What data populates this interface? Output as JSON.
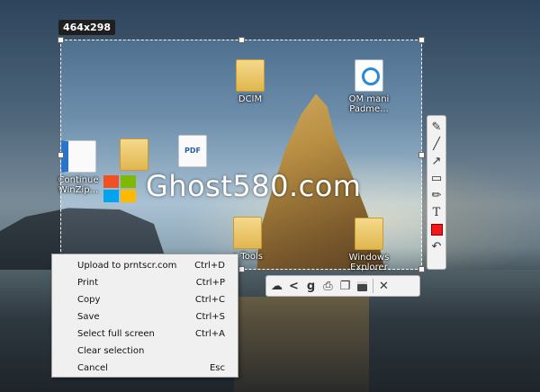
{
  "selection": {
    "size_label": "464x298"
  },
  "watermark": "Ghost580.com",
  "desktop_icons": [
    {
      "label": "DCIM",
      "icon": "folder-icon"
    },
    {
      "label": "OM mani\nPadme...",
      "icon": "app-icon"
    },
    {
      "label": "Continue\nWinZip...",
      "icon": "document-icon"
    },
    {
      "label": "",
      "icon": "folder-icon"
    },
    {
      "label": "",
      "icon": "pdf-document-icon",
      "glyph_text": "PDF"
    },
    {
      "label": "e Tools",
      "icon": "zip-folder-icon"
    },
    {
      "label": "Windows\nExplorer",
      "icon": "folder-icon"
    }
  ],
  "vertical_toolbar": {
    "tools": [
      {
        "name": "pen-tool",
        "glyph": "✎"
      },
      {
        "name": "line-tool",
        "glyph": "╱"
      },
      {
        "name": "arrow-tool",
        "glyph": "↗"
      },
      {
        "name": "rectangle-tool",
        "glyph": "▭"
      },
      {
        "name": "marker-tool",
        "glyph": "✏"
      },
      {
        "name": "text-tool",
        "glyph": "T"
      },
      {
        "name": "color-picker",
        "color": "#f21818"
      },
      {
        "name": "undo-tool",
        "glyph": "↶"
      }
    ]
  },
  "horizontal_toolbar": {
    "tools": [
      {
        "name": "upload-cloud",
        "glyph": "☁"
      },
      {
        "name": "share",
        "glyph": "<"
      },
      {
        "name": "google-search",
        "glyph": "g"
      },
      {
        "name": "print",
        "glyph": "⎙"
      },
      {
        "name": "copy",
        "glyph": "❐"
      },
      {
        "name": "save",
        "glyph": "💾"
      },
      {
        "name": "close",
        "glyph": "✕"
      }
    ]
  },
  "context_menu": {
    "items": [
      {
        "label": "Upload to prntscr.com",
        "shortcut": "Ctrl+D"
      },
      {
        "label": "Print",
        "shortcut": "Ctrl+P"
      },
      {
        "label": "Copy",
        "shortcut": "Ctrl+C"
      },
      {
        "label": "Save",
        "shortcut": "Ctrl+S"
      },
      {
        "label": "Select full screen",
        "shortcut": "Ctrl+A"
      },
      {
        "label": "Clear selection",
        "shortcut": ""
      },
      {
        "label": "Cancel",
        "shortcut": "Esc"
      }
    ]
  },
  "colors": {
    "logo": [
      "#f25022",
      "#7fba00",
      "#00a4ef",
      "#ffb900"
    ]
  }
}
